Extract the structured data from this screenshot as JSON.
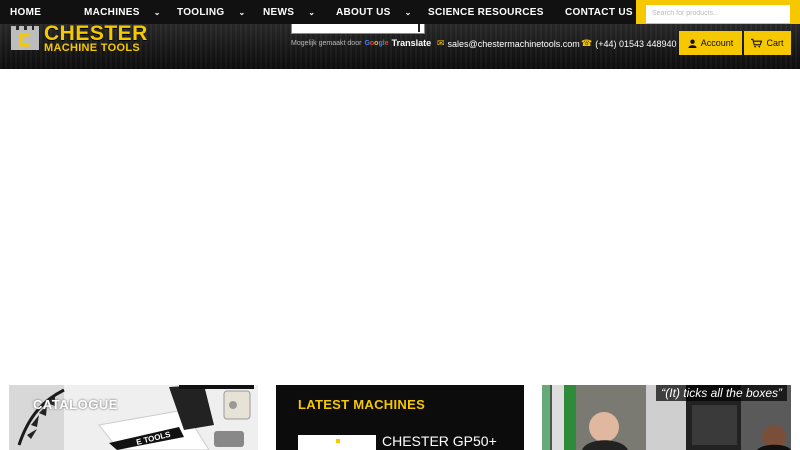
{
  "nav": {
    "items": [
      {
        "label": "HOME",
        "dropdown": false
      },
      {
        "label": "MACHINES",
        "dropdown": true
      },
      {
        "label": "TOOLING",
        "dropdown": true
      },
      {
        "label": "NEWS",
        "dropdown": true
      },
      {
        "label": "ABOUT US",
        "dropdown": true
      },
      {
        "label": "SCIENCE RESOURCES",
        "dropdown": false
      },
      {
        "label": "CONTACT US",
        "dropdown": false
      }
    ],
    "search_placeholder": "Search for products..."
  },
  "header": {
    "logo_line1": "CHESTER",
    "logo_line2": "MACHINE TOOLS",
    "translate_by": "Mogelijk gemaakt door",
    "translate_google": "Google",
    "translate_label": "Translate",
    "email": "sales@chestermachinetools.com",
    "phone": "(+44) 01543 448940",
    "account_label": "Account",
    "cart_label": "Cart"
  },
  "cards": {
    "catalogue_title": "CATALOGUE",
    "catalogue_book_text": "E TOOLS",
    "latest_title": "LATEST MACHINES",
    "latest_machine_name": "CHESTER GP50+",
    "video_quote": "“(It) ticks all the boxes”"
  },
  "colors": {
    "accent": "#f6c800",
    "nav_bg": "#111111"
  }
}
